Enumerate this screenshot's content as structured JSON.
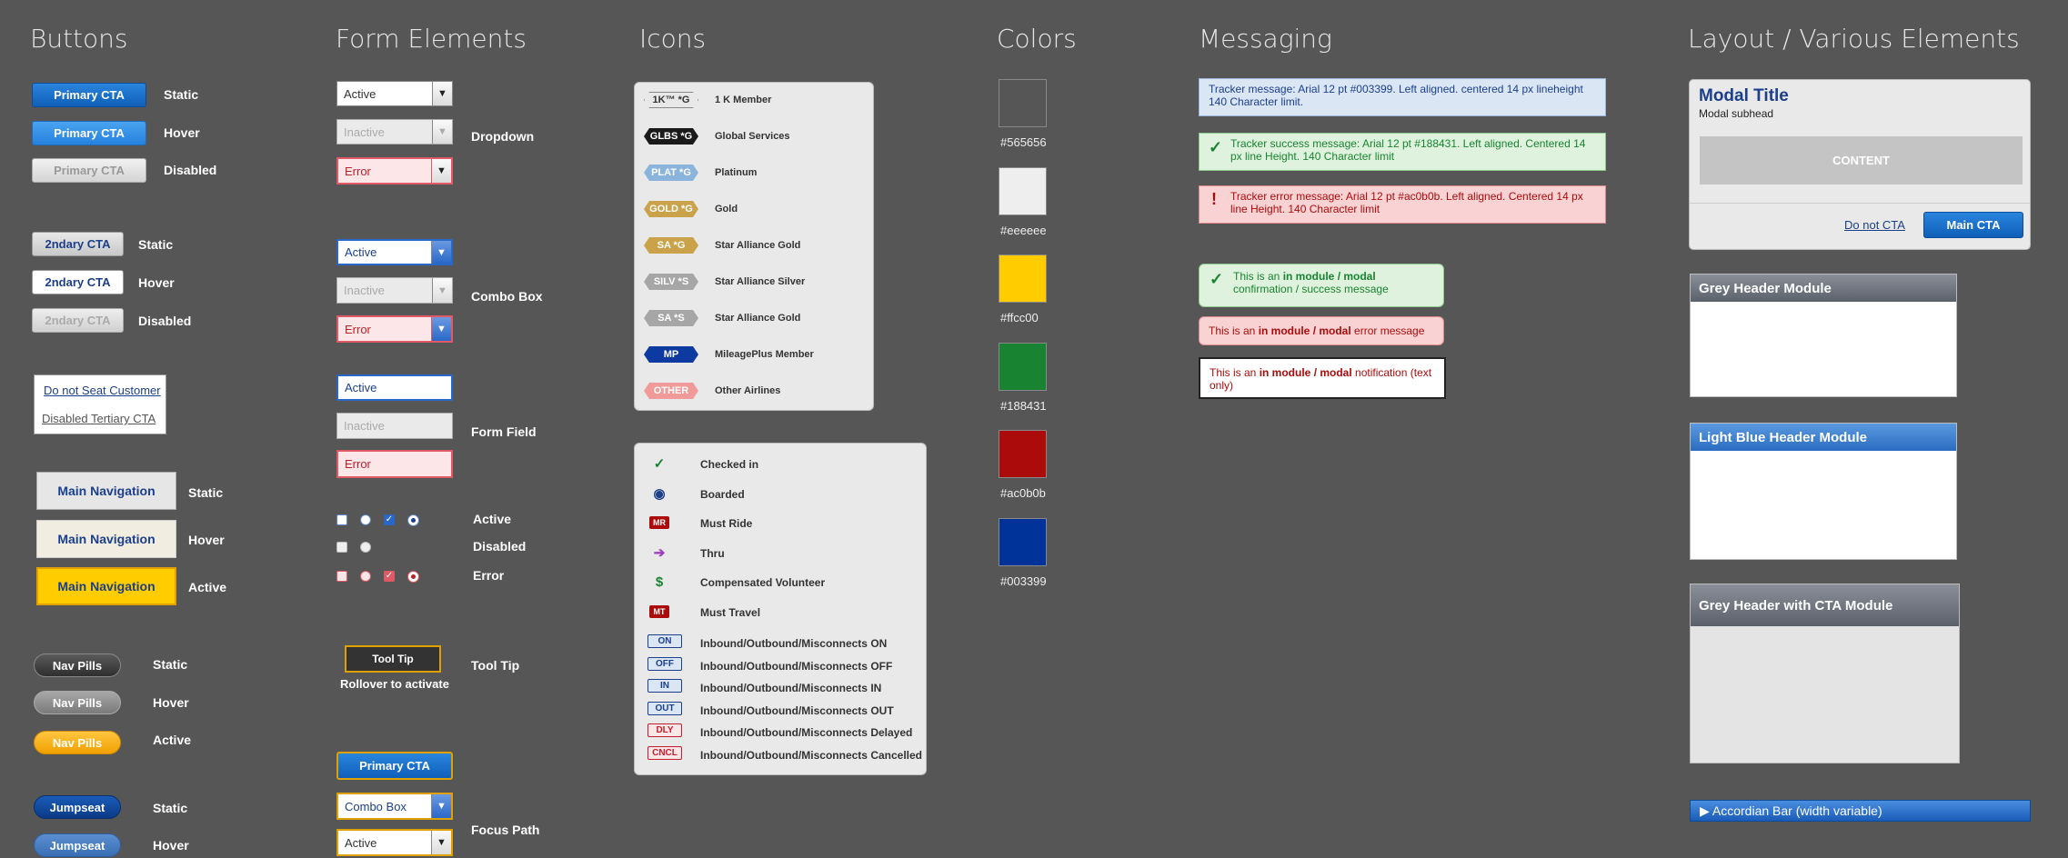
{
  "headings": {
    "buttons": "Buttons",
    "forms": "Form Elements",
    "icons": "Icons",
    "colors": "Colors",
    "messaging": "Messaging",
    "layout": "Layout / Various Elements"
  },
  "buttons": {
    "primary_label": "Primary CTA",
    "secondary_label": "2ndary CTA",
    "state_static": "Static",
    "state_hover": "Hover",
    "state_disabled": "Disabled",
    "state_active": "Active",
    "tertiary_1": "Do not Seat Customer",
    "tertiary_2": "Disabled Tertiary CTA",
    "main_nav": "Main Navigation",
    "nav_pills": "Nav Pills",
    "jumpseat": "Jumpseat"
  },
  "forms": {
    "active": "Active",
    "inactive": "Inactive",
    "error": "Error",
    "dropdown_label": "Dropdown",
    "combo_label": "Combo Box",
    "field_label": "Form Field",
    "cb_active": "Active",
    "cb_disabled": "Disabled",
    "cb_error": "Error",
    "tooltip_text": "Tool Tip",
    "tooltip_sub": "Rollover to activate",
    "tooltip_label": "Tool Tip",
    "focus_primary": "Primary CTA",
    "focus_combo": "Combo Box",
    "focus_active": "Active",
    "focus_label": "Focus Path"
  },
  "icons": {
    "member": [
      {
        "tag": "1K™ *G",
        "label": "1 K Member",
        "bg": "#e8e8e8",
        "fg": "#333"
      },
      {
        "tag": "GLBS *G",
        "label": "Global Services",
        "bg": "#1a1a1a",
        "fg": "#fff"
      },
      {
        "tag": "PLAT *G",
        "label": "Platinum",
        "bg": "#8ab4dc",
        "fg": "#fff"
      },
      {
        "tag": "GOLD *G",
        "label": "Gold",
        "bg": "#c9a24a",
        "fg": "#fff"
      },
      {
        "tag": "SA *G",
        "label": "Star Alliance Gold",
        "bg": "#c9a24a",
        "fg": "#fff"
      },
      {
        "tag": "SILV *S",
        "label": "Star Alliance Silver",
        "bg": "#a6a6a6",
        "fg": "#fff"
      },
      {
        "tag": "SA *S",
        "label": "Star Alliance Gold",
        "bg": "#a6a6a6",
        "fg": "#fff"
      },
      {
        "tag": "MP",
        "label": "MileagePlus Member",
        "bg": "#0c3aa0",
        "fg": "#fff"
      },
      {
        "tag": "OTHER",
        "label": "Other Airlines",
        "bg": "#f19a9a",
        "fg": "#fff"
      }
    ],
    "status": [
      {
        "icon": "check-icon",
        "glyph": "✓",
        "label": "Checked in",
        "color": "#188431"
      },
      {
        "icon": "boarded-icon",
        "glyph": "◉",
        "label": "Boarded",
        "color": "#1c3f8c"
      },
      {
        "icon": "must-ride-icon",
        "glyph": "MR",
        "label": "Must Ride",
        "color": "#ac0b0b"
      },
      {
        "icon": "thru-icon",
        "glyph": "➔",
        "label": "Thru",
        "color": "#a040c0"
      },
      {
        "icon": "dollar-icon",
        "glyph": "$",
        "label": "Compensated Volunteer",
        "color": "#188431"
      },
      {
        "icon": "must-travel-icon",
        "glyph": "MT",
        "label": "Must Travel",
        "color": "#ac0b0b"
      },
      {
        "icon": "on-icon",
        "glyph": "ON",
        "label": "Inbound/Outbound/Misconnects ON",
        "color": "#1c3f8c"
      },
      {
        "icon": "off-icon",
        "glyph": "OFF",
        "label": "Inbound/Outbound/Misconnects OFF",
        "color": "#1c3f8c"
      },
      {
        "icon": "in-icon",
        "glyph": "IN",
        "label": "Inbound/Outbound/Misconnects IN",
        "color": "#1c3f8c"
      },
      {
        "icon": "out-icon",
        "glyph": "OUT",
        "label": "Inbound/Outbound/Misconnects OUT",
        "color": "#1c3f8c"
      },
      {
        "icon": "dly-icon",
        "glyph": "DLY",
        "label": "Inbound/Outbound/Misconnects Delayed",
        "color": "#c0202c"
      },
      {
        "icon": "cncl-icon",
        "glyph": "CNCL",
        "label": "Inbound/Outbound/Misconnects Cancelled",
        "color": "#c0202c"
      }
    ]
  },
  "colors": [
    {
      "hex": "#565656",
      "label": "#565656"
    },
    {
      "hex": "#eeeeee",
      "label": "#eeeeee"
    },
    {
      "hex": "#ffcc00",
      "label": "#ffcc00"
    },
    {
      "hex": "#188431",
      "label": "#188431"
    },
    {
      "hex": "#ac0b0b",
      "label": "#ac0b0b"
    },
    {
      "hex": "#003399",
      "label": "#003399"
    }
  ],
  "messaging": {
    "tracker": "Tracker message:  Arial 12 pt #003399. Left aligned. centered 14 px lineheight 140 Character limit.",
    "success": "Tracker success message:  Arial 12 pt #188431. Left aligned. Centered 14 px line Height. 140 Character limit",
    "error": "Tracker error message:  Arial 12 pt #ac0b0b. Left aligned. Centered 14 px line Height. 140 Character limit",
    "mod_success_pre": "This is an ",
    "mod_success_bold": "in module / modal",
    "mod_success_post": " confirmation / success message",
    "mod_error_pre": "This is an ",
    "mod_error_bold": "in module / modal",
    "mod_error_post": " error message",
    "mod_note_pre": "This is an ",
    "mod_note_bold": "in module / modal",
    "mod_note_post": " notification (text only)"
  },
  "layout": {
    "modal_title": "Modal Title",
    "modal_subhead": "Modal subhead",
    "modal_content": "CONTENT",
    "modal_link": "Do not CTA",
    "modal_cta": "Main CTA",
    "grey_header": "Grey Header Module",
    "blue_header": "Light Blue Header Module",
    "grey_cta_header": "Grey Header with CTA Module",
    "accordion": "▶ Accordian Bar (width variable)"
  }
}
